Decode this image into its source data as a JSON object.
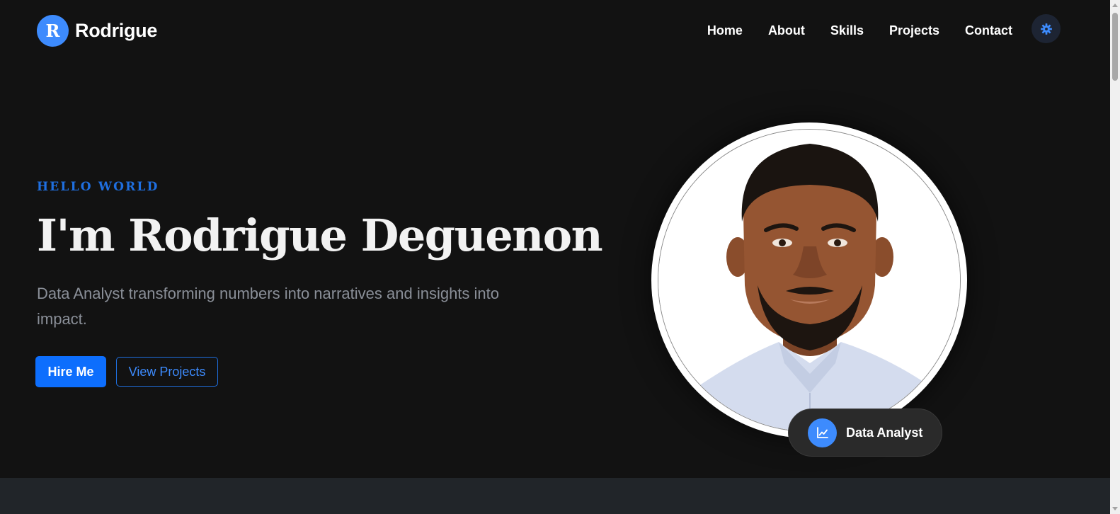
{
  "brand": {
    "initial": "R",
    "name": "Rodrigue"
  },
  "nav": {
    "links": [
      "Home",
      "About",
      "Skills",
      "Projects",
      "Contact"
    ]
  },
  "theme_toggle": {
    "icon": "gear-icon"
  },
  "hero": {
    "eyebrow": "HELLO WORLD",
    "headline": "I'm Rodrigue Deguenon",
    "tagline": "Data Analyst transforming numbers into narratives and insights into impact.",
    "primary_button": "Hire Me",
    "secondary_button": "View Projects",
    "role_badge": "Data Analyst"
  },
  "colors": {
    "background": "#121212",
    "accent": "#0d6efd",
    "accent_light": "#3d8bfd",
    "muted_text": "#8a8f98",
    "section_dark": "#212529"
  }
}
